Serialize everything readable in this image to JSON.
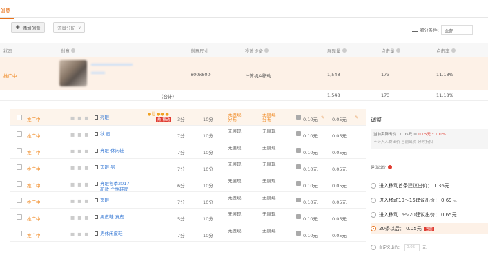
{
  "tab": {
    "active_label": "创意"
  },
  "toolbar": {
    "add_label": "添加创意",
    "traffic_label": "流量分配",
    "metric_filter_label": "细分条件:",
    "metric_filter_value": "全部"
  },
  "table1": {
    "headers": [
      "状态",
      "创意",
      "创意尺寸",
      "投放设备",
      "展现量",
      "点击量",
      "点击率"
    ],
    "row": {
      "status": "推广中",
      "size": "800x800",
      "device": "计算机&移动",
      "impressions": "1,548",
      "clicks": "173",
      "ctr": "11.18%"
    },
    "total": {
      "label": "（合计）",
      "impressions": "1,548",
      "clicks": "173",
      "ctr": "11.18%"
    }
  },
  "table2": {
    "dots": "■ ■ ■",
    "tags": {
      "top": "●让 ●● ●",
      "bottom": "热 移动"
    },
    "rows": [
      {
        "status": "推广中",
        "name": "亮眼",
        "c1": "3分",
        "c2": "10分",
        "t1a": "无展现",
        "t1b": "分布",
        "t2a": "无展现",
        "t2b": "分布",
        "bid": "0.10元",
        "bid2": "0.05元",
        "first": true
      },
      {
        "status": "推广中",
        "name": "秋 画",
        "c1": "7分",
        "c2": "10分",
        "t1a": "无展现",
        "t1b": "",
        "t2a": "无展现",
        "t2b": "",
        "bid": "0.10元",
        "bid2": "0.05元"
      },
      {
        "status": "推广中",
        "name": "亮眼 休闲鞋",
        "c1": "7分",
        "c2": "10分",
        "t1a": "无展现",
        "t1b": "",
        "t2a": "无展现",
        "t2b": "",
        "bid": "0.10元",
        "bid2": "0.05元"
      },
      {
        "status": "推广中",
        "name": "页眼 男",
        "c1": "7分",
        "c2": "10分",
        "t1a": "无展现",
        "t1b": "",
        "t2a": "无展现",
        "t2b": "",
        "bid": "0.10元",
        "bid2": "0.05元"
      },
      {
        "status": "推广中",
        "name": "亮眼冬季2017",
        "name2": "新款 个性鞋面",
        "c1": "6分",
        "c2": "10分",
        "t1a": "无展现",
        "t1b": "",
        "t2a": "无展现",
        "t2b": "",
        "bid": "0.10元",
        "bid2": "0.05元"
      },
      {
        "status": "推广中",
        "name": "页眼",
        "c1": "7分",
        "c2": "10分",
        "t1a": "无展现",
        "t1b": "",
        "t2a": "无展现",
        "t2b": "",
        "bid": "0.10元",
        "bid2": "0.05元"
      },
      {
        "status": "推广中",
        "name": "男皮鞋 真皮",
        "c1": "5分",
        "c2": "10分",
        "t1a": "无展现",
        "t1b": "",
        "t2a": "无展现",
        "t2b": "",
        "bid": "0.10元",
        "bid2": "0.05元"
      },
      {
        "status": "推广中",
        "name": "男休闲皮鞋",
        "c1": "7分",
        "c2": "10分",
        "t1a": "无展现",
        "t1b": "",
        "t2a": "无展现",
        "t2b": "",
        "bid": "0.10元",
        "bid2": "0.05元"
      }
    ]
  },
  "panel": {
    "title": "调整",
    "calc_line1_a": "当前实际出价：0.05元 ＝ ",
    "calc_line1_red": "0.05元",
    "calc_line1_b": " * 100%",
    "calc_line2": "不计入人群出价                当前出价    分时折扣",
    "sugg_label": "建议出价",
    "options": [
      {
        "label": "进入移动首条建议出价：  1.36元"
      },
      {
        "label": "进入移动10～15建议出价：  0.69元"
      },
      {
        "label": "进入移动16～20建议出价：  0.65元"
      }
    ],
    "selected_label": "20条以后：  0.05元",
    "selected_badge": "当前",
    "custom_label": "自定义出价：",
    "custom_placeholder": "0.05",
    "custom_unit": "元"
  }
}
